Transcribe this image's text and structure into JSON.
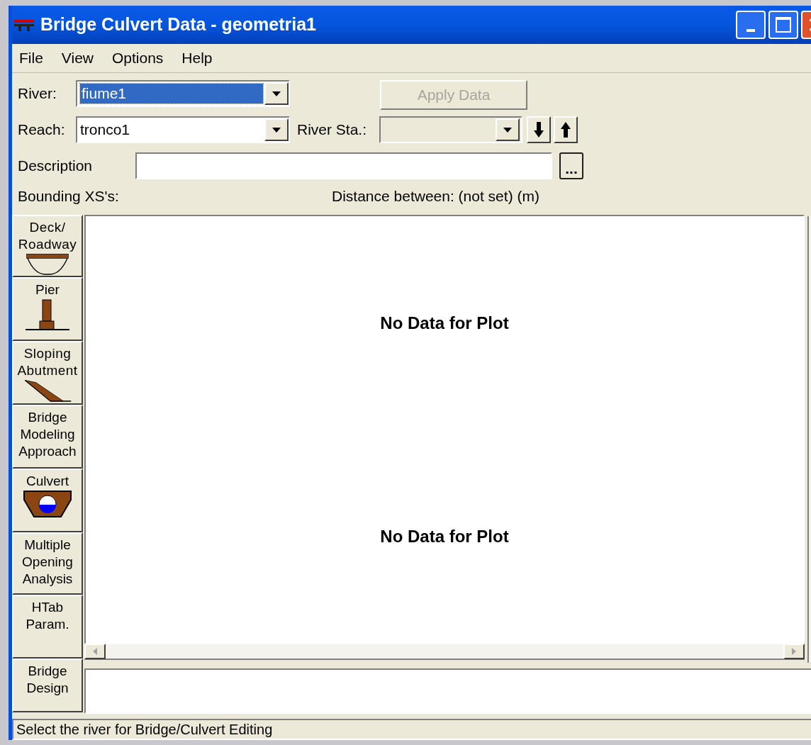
{
  "window": {
    "title": "Bridge Culvert Data - geometria1"
  },
  "menu": [
    "File",
    "View",
    "Options",
    "Help"
  ],
  "form": {
    "river": {
      "label": "River:",
      "value": "fiume1"
    },
    "apply_button": {
      "label": "Apply Data",
      "disabled": true
    },
    "reach": {
      "label": "Reach:",
      "value": "tronco1"
    },
    "river_station": {
      "label": "River Sta.:"
    },
    "description": {
      "label": "Description",
      "button": "..."
    },
    "bounding": "Bounding XS's:",
    "distance": "Distance between: (not set) (m)"
  },
  "tools": [
    {
      "label": "Deck/\nRoadway",
      "kind": "deck"
    },
    {
      "label": "Pier",
      "kind": "pier"
    },
    {
      "label": "Sloping\nAbutment",
      "kind": "abutment"
    },
    {
      "label": "Bridge\nModeling\nApproach",
      "kind": "text"
    },
    {
      "label": "Culvert",
      "kind": "culvert"
    },
    {
      "label": "Multiple\nOpening\nAnalysis",
      "kind": "text"
    },
    {
      "label": "HTab\nParam.",
      "kind": "text"
    },
    {
      "label": "Bridge\nDesign",
      "kind": "text"
    }
  ],
  "plots": [
    {
      "message": "No Data for Plot"
    },
    {
      "message": "No Data for Plot"
    }
  ],
  "status_bar": "Select the river for Bridge/Culvert Editing"
}
